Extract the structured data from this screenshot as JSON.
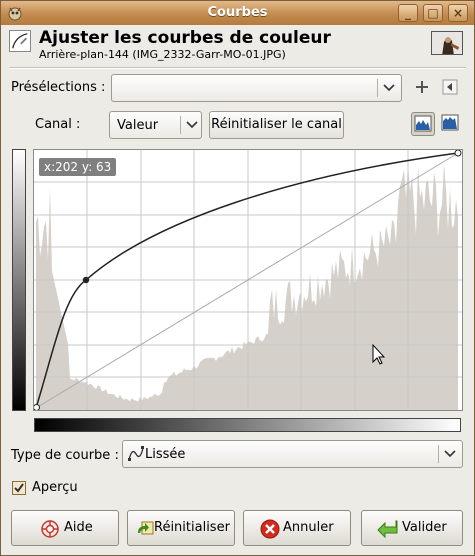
{
  "window": {
    "title": "Courbes",
    "buttons": {
      "minimize": "_",
      "maximize": "□",
      "close": "×"
    }
  },
  "header": {
    "title": "Ajuster les courbes de couleur",
    "subtitle": "Arrière-plan-144 (IMG_2332-Garr-MO-01.JPG)"
  },
  "presets": {
    "label": "Présélections :",
    "value": ""
  },
  "channel": {
    "label": "Canal :",
    "value": "Valeur",
    "reset_label": "Réinitialiser le canal"
  },
  "curve": {
    "coords_readout": "x:202 y: 63"
  },
  "curve_type": {
    "label": "Type de courbe :",
    "value": "Lissée"
  },
  "preview": {
    "label": "Aperçu",
    "checked": true
  },
  "buttons": {
    "help": "Aide",
    "reset": "Réinitialiser",
    "cancel": "Annuler",
    "ok": "Valider"
  },
  "colors": {
    "titlebar": "#c38b4f",
    "window_bg": "#ecebe6",
    "histogram": "#d5d0c9",
    "grid": "#d0d0d0"
  }
}
